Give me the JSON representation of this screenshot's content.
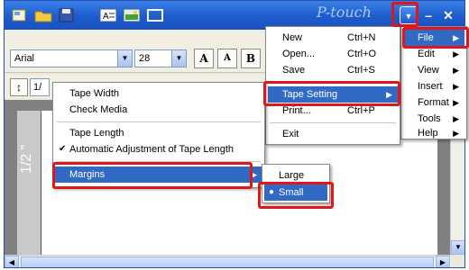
{
  "app": {
    "logo_text": "P-touch"
  },
  "toolbar_icons": [
    "new-layout-icon",
    "open-folder-icon",
    "save-disk-icon",
    "text-icon",
    "image-icon",
    "frame-icon"
  ],
  "font": {
    "family": "Arial",
    "size": "28"
  },
  "format_buttons": [
    "A",
    "A",
    "B"
  ],
  "tape_width_field": "1/",
  "ruler_label": "1/2 \"",
  "main_menu": {
    "items": [
      {
        "label": "File",
        "highlighted": true
      },
      {
        "label": "Edit"
      },
      {
        "label": "View"
      },
      {
        "label": "Insert"
      },
      {
        "label": "Format"
      },
      {
        "label": "Tools"
      },
      {
        "label": "Help"
      }
    ]
  },
  "file_menu": {
    "items": [
      {
        "label": "New",
        "shortcut": "Ctrl+N"
      },
      {
        "label": "Open...",
        "shortcut": "Ctrl+O"
      },
      {
        "label": "Save",
        "shortcut": "Ctrl+S"
      },
      {
        "label": "Tape Setting",
        "highlighted": true
      },
      {
        "label": "Print...",
        "shortcut": "Ctrl+P"
      },
      {
        "label": "Exit"
      }
    ]
  },
  "tape_menu": {
    "items": [
      {
        "label": "Tape Width"
      },
      {
        "label": "Check Media"
      },
      {
        "label": "Tape Length"
      },
      {
        "label": "Automatic Adjustment of Tape Length",
        "checked": true
      },
      {
        "label": "Margins",
        "highlighted": true
      }
    ]
  },
  "margins_menu": {
    "items": [
      {
        "label": "Large"
      },
      {
        "label": "Small",
        "selected": true,
        "highlighted": true
      }
    ]
  },
  "colors": {
    "highlight": "#316ac5",
    "callout": "#e0161b",
    "titlebar": "#1d5ccc"
  }
}
